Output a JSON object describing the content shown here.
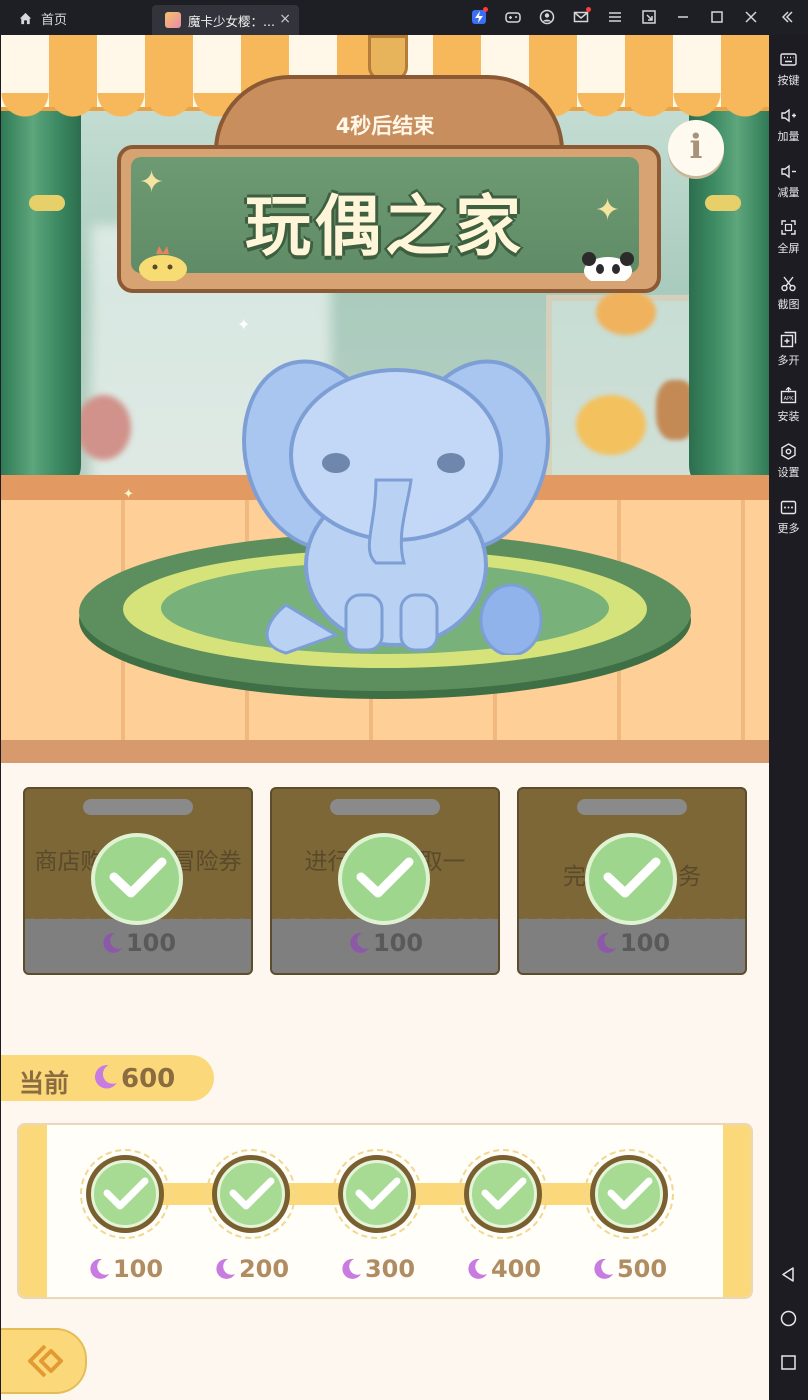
{
  "titlebar": {
    "home_label": "首页",
    "tab_title": "魔卡少女樱：...",
    "tab_close": "×"
  },
  "sidebar": {
    "items": [
      {
        "label": "按键",
        "icon": "keyboard-icon"
      },
      {
        "label": "加量",
        "icon": "volume-up-icon"
      },
      {
        "label": "减量",
        "icon": "volume-down-icon"
      },
      {
        "label": "全屏",
        "icon": "fullscreen-icon"
      },
      {
        "label": "截图",
        "icon": "scissors-icon"
      },
      {
        "label": "多开",
        "icon": "multi-instance-icon"
      },
      {
        "label": "安装",
        "icon": "apk-install-icon"
      },
      {
        "label": "设置",
        "icon": "gear-icon"
      },
      {
        "label": "更多",
        "icon": "more-icon"
      }
    ]
  },
  "game": {
    "countdown": "4秒后结束",
    "title": "玩偶之家",
    "info_label": "i",
    "tasks": [
      {
        "text": "商店购买高级冒险券",
        "reward": "100",
        "done": true
      },
      {
        "text": "进行签到领取一",
        "reward": "100",
        "done": true
      },
      {
        "text": "完成所有任务",
        "reward": "100",
        "done": true
      }
    ],
    "current_label": "当前",
    "current_value": "600",
    "milestones": [
      {
        "value": "100",
        "done": true
      },
      {
        "value": "200",
        "done": true
      },
      {
        "value": "300",
        "done": true
      },
      {
        "value": "400",
        "done": true
      },
      {
        "value": "500",
        "done": true
      }
    ]
  },
  "colors": {
    "titlebar_bg": "#1e1f24",
    "sidebar_bg": "#1c1c22",
    "sign_green": "#6e9a73",
    "pill_yellow": "#fbd97a",
    "check_green": "#9fd68d",
    "moon_purple": "#c87be0"
  }
}
